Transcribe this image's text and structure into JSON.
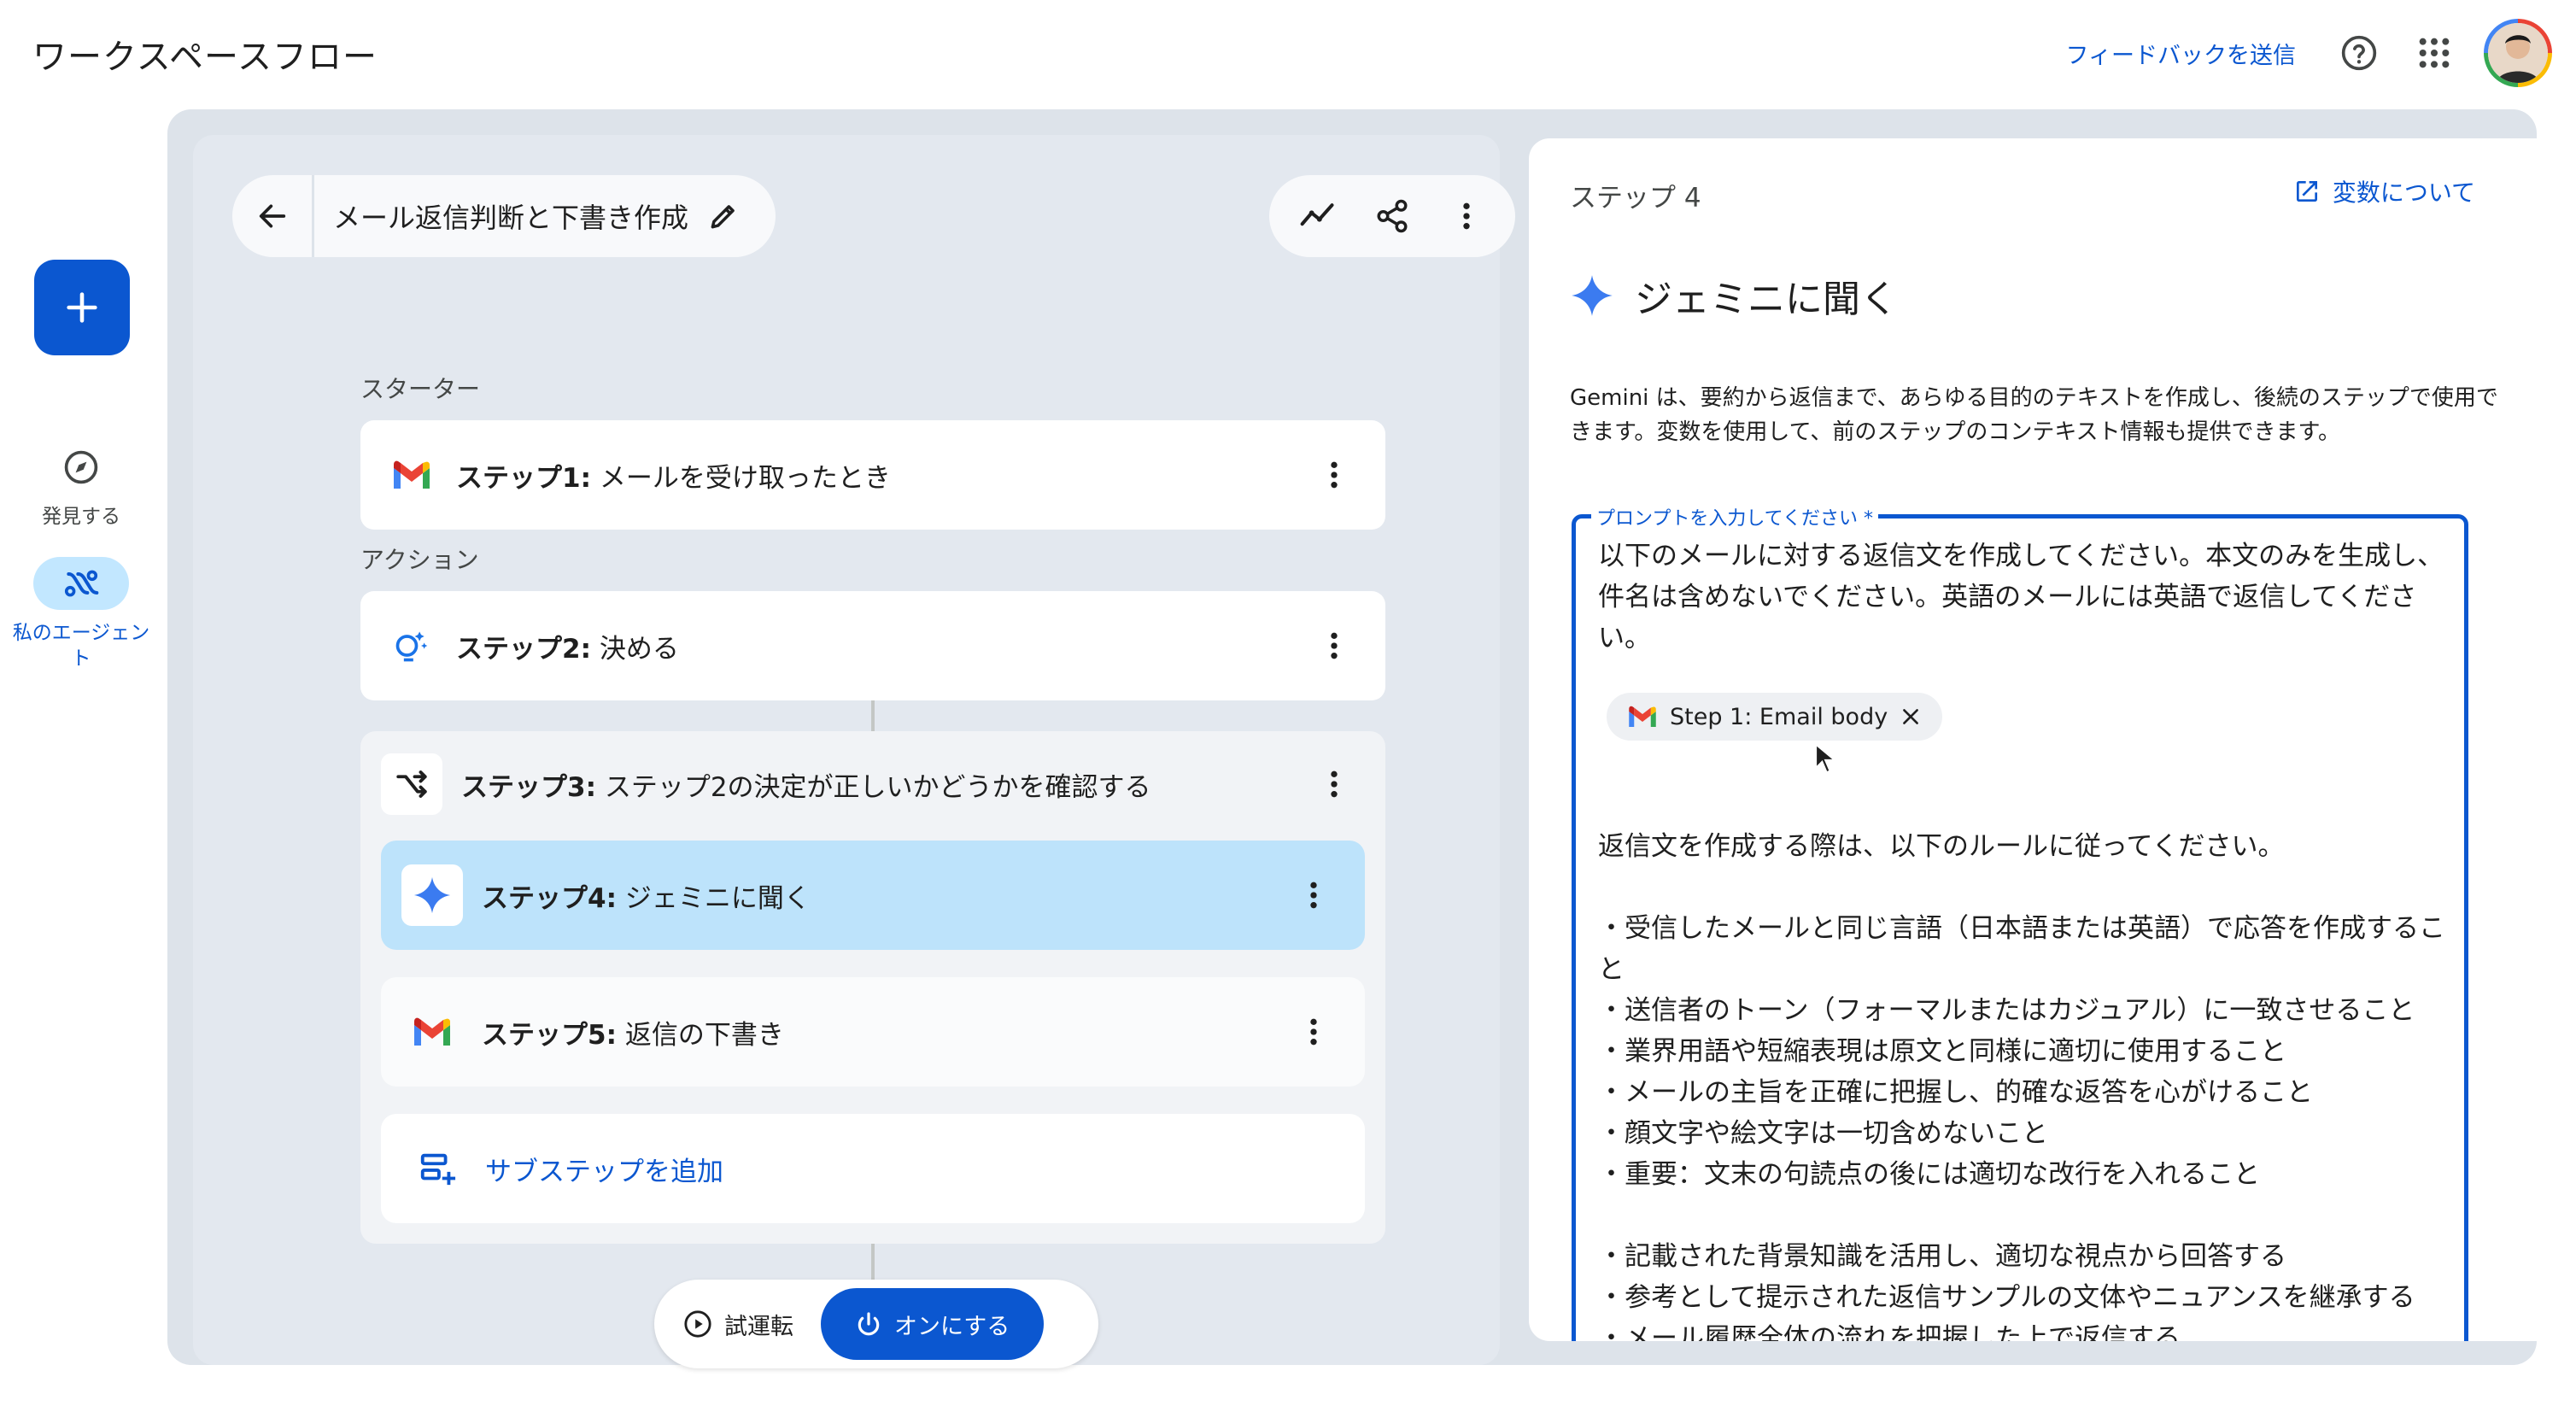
{
  "app": {
    "title": "ワークスペースフロー",
    "feedback": "フィードバックを送信"
  },
  "icons": {
    "help": "help-circle-icon",
    "apps": "apps-grid-icon",
    "avatar": "user-avatar"
  },
  "rail": {
    "discover": "発見する",
    "my_agents": "私のエージェント"
  },
  "flow": {
    "name": "メール返信判断と下書き作成",
    "starter_label": "スターター",
    "action_label": "アクション",
    "step1": {
      "prefix": "ステップ1:",
      "text": " メールを受け取ったとき"
    },
    "step2": {
      "prefix": "ステップ2:",
      "text": " 決める"
    },
    "step3": {
      "prefix": "ステップ3:",
      "text": " ステップ2の決定が正しいかどうかを確認する"
    },
    "step4": {
      "prefix": "ステップ4:",
      "text": " ジェミニに聞く"
    },
    "step5": {
      "prefix": "ステップ5:",
      "text": " 返信の下書き"
    },
    "add_substep": "サブステップを追加",
    "test_run": "試運転",
    "turn_on": "オンにする"
  },
  "panel": {
    "step_number": "ステップ 4",
    "variables_link": "変数について",
    "title": "ジェミニに聞く",
    "description": "Gemini は、要約から返信まで、あらゆる目的のテキストを作成し、後続のステップで使用できます。変数を使用して、前のステップのコンテキスト情報も提供できます。",
    "prompt_label": "プロンプトを入力してください *",
    "prompt_intro": "以下のメールに対する返信文を作成してください。本文のみを生成し、件名は含めないでください。英語のメールには英語で返信してください。",
    "chip": "Step 1: Email body",
    "rules_lines": [
      "返信文を作成する際は、以下のルールに従ってください。",
      "",
      "・受信したメールと同じ言語（日本語または英語）で応答を作成すること",
      "・送信者のトーン（フォーマルまたはカジュアル）に一致させること",
      "・業界用語や短縮表現は原文と同様に適切に使用すること",
      "・メールの主旨を正確に把握し、的確な返答を心がけること",
      "・顔文字や絵文字は一切含めないこと",
      "・重要：文末の句読点の後には適切な改行を入れること",
      "",
      "・記載された背景知識を活用し、適切な視点から回答する",
      "・参考として提示された返信サンプルの文体やニュアンスを継承する",
      "・メール履歴全体の流れを把握した上で返信する"
    ]
  },
  "colors": {
    "accent": "#0b57d0",
    "selected_bg": "#bde3fb",
    "canvas_bg": "#dde3ea"
  }
}
